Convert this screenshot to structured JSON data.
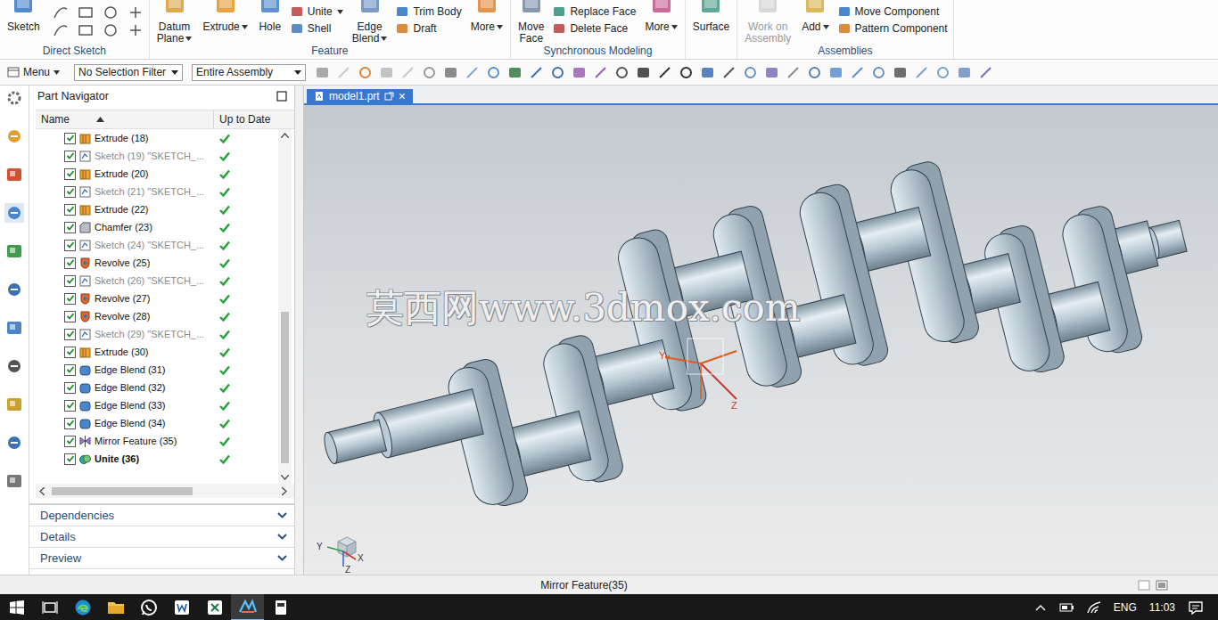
{
  "ribbon": {
    "groups": [
      {
        "label": "Direct Sketch",
        "items": [
          {
            "kind": "large",
            "lines": [
              "Sketch"
            ],
            "caret": false,
            "disabled": false
          },
          {
            "kind": "sketch-tools"
          }
        ]
      },
      {
        "label": "Feature",
        "items": [
          {
            "kind": "large",
            "lines": [
              "Datum",
              "Plane"
            ],
            "caret": true,
            "disabled": false
          },
          {
            "kind": "large",
            "lines": [
              "Extrude"
            ],
            "caret": true,
            "disabled": false
          },
          {
            "kind": "large",
            "lines": [
              "Hole"
            ],
            "caret": false,
            "disabled": false
          },
          {
            "kind": "stack",
            "buttons": [
              {
                "label": "Unite",
                "caret": true
              },
              {
                "label": "Shell",
                "caret": false
              }
            ]
          },
          {
            "kind": "large",
            "lines": [
              "Edge",
              "Blend"
            ],
            "caret": true,
            "disabled": false
          },
          {
            "kind": "stack",
            "buttons": [
              {
                "label": "Trim Body",
                "caret": false
              },
              {
                "label": "Draft",
                "caret": false
              }
            ]
          },
          {
            "kind": "large",
            "lines": [
              "More"
            ],
            "caret": true,
            "disabled": false
          }
        ]
      },
      {
        "label": "Synchronous Modeling",
        "items": [
          {
            "kind": "large",
            "lines": [
              "Move",
              "Face"
            ],
            "caret": false,
            "disabled": false
          },
          {
            "kind": "stack",
            "buttons": [
              {
                "label": "Replace Face",
                "caret": false
              },
              {
                "label": "Delete Face",
                "caret": false
              }
            ]
          },
          {
            "kind": "large",
            "lines": [
              "More"
            ],
            "caret": true,
            "disabled": false
          }
        ]
      },
      {
        "items": [
          {
            "kind": "large",
            "lines": [
              "Surface"
            ],
            "caret": false,
            "disabled": false
          }
        ]
      },
      {
        "label": "Assemblies",
        "items": [
          {
            "kind": "large",
            "lines": [
              "Work on",
              "Assembly"
            ],
            "caret": false,
            "disabled": true
          },
          {
            "kind": "large",
            "lines": [
              "Add"
            ],
            "caret": true,
            "disabled": false
          },
          {
            "kind": "stack",
            "buttons": [
              {
                "label": "Move Component",
                "caret": false
              },
              {
                "label": "Pattern Component",
                "caret": false
              }
            ]
          }
        ]
      }
    ]
  },
  "toolbar": {
    "menu": "Menu",
    "selection_filter": "No Selection Filter",
    "scope": "Entire Assembly"
  },
  "navigator": {
    "title": "Part Navigator",
    "columns": [
      "Name",
      "Up to Date"
    ],
    "sort_ascending": true,
    "rows": [
      {
        "name": "Extrude (18)",
        "kind": "extrude",
        "checked": true,
        "up_to_date": true,
        "greyed": false,
        "current": false
      },
      {
        "name": "Sketch (19) \"SKETCH_...",
        "kind": "sketch",
        "checked": true,
        "up_to_date": true,
        "greyed": true,
        "current": false
      },
      {
        "name": "Extrude (20)",
        "kind": "extrude",
        "checked": true,
        "up_to_date": true,
        "greyed": false,
        "current": false
      },
      {
        "name": "Sketch (21) \"SKETCH_...",
        "kind": "sketch",
        "checked": true,
        "up_to_date": true,
        "greyed": true,
        "current": false
      },
      {
        "name": "Extrude (22)",
        "kind": "extrude",
        "checked": true,
        "up_to_date": true,
        "greyed": false,
        "current": false
      },
      {
        "name": "Chamfer (23)",
        "kind": "chamfer",
        "checked": true,
        "up_to_date": true,
        "greyed": false,
        "current": false
      },
      {
        "name": "Sketch (24) \"SKETCH_...",
        "kind": "sketch",
        "checked": true,
        "up_to_date": true,
        "greyed": true,
        "current": false
      },
      {
        "name": "Revolve (25)",
        "kind": "revolve",
        "checked": true,
        "up_to_date": true,
        "greyed": false,
        "current": false
      },
      {
        "name": "Sketch (26) \"SKETCH_...",
        "kind": "sketch",
        "checked": true,
        "up_to_date": true,
        "greyed": true,
        "current": false
      },
      {
        "name": "Revolve (27)",
        "kind": "revolve",
        "checked": true,
        "up_to_date": true,
        "greyed": false,
        "current": false
      },
      {
        "name": "Revolve (28)",
        "kind": "revolve",
        "checked": true,
        "up_to_date": true,
        "greyed": false,
        "current": false
      },
      {
        "name": "Sketch (29) \"SKETCH_...",
        "kind": "sketch",
        "checked": true,
        "up_to_date": true,
        "greyed": true,
        "current": false
      },
      {
        "name": "Extrude (30)",
        "kind": "extrude",
        "checked": true,
        "up_to_date": true,
        "greyed": false,
        "current": false
      },
      {
        "name": "Edge Blend (31)",
        "kind": "blend",
        "checked": true,
        "up_to_date": true,
        "greyed": false,
        "current": false
      },
      {
        "name": "Edge Blend (32)",
        "kind": "blend",
        "checked": true,
        "up_to_date": true,
        "greyed": false,
        "current": false
      },
      {
        "name": "Edge Blend (33)",
        "kind": "blend",
        "checked": true,
        "up_to_date": true,
        "greyed": false,
        "current": false
      },
      {
        "name": "Edge Blend (34)",
        "kind": "blend",
        "checked": true,
        "up_to_date": true,
        "greyed": false,
        "current": false
      },
      {
        "name": "Mirror Feature (35)",
        "kind": "mirror",
        "checked": true,
        "up_to_date": true,
        "greyed": false,
        "current": false
      },
      {
        "name": "Unite (36)",
        "kind": "unite",
        "checked": true,
        "up_to_date": true,
        "greyed": false,
        "current": true
      }
    ],
    "sections": [
      {
        "label": "Dependencies",
        "expanded": false
      },
      {
        "label": "Details",
        "expanded": false
      },
      {
        "label": "Preview",
        "expanded": false
      }
    ]
  },
  "viewport": {
    "tab": {
      "label": "model1.prt",
      "close": "×",
      "selected": true
    },
    "watermark": "莫西网www.3dmox.com",
    "datum_csys": {
      "y": "Y",
      "z": "Z"
    },
    "view_triad": {
      "x": "X",
      "y": "Y",
      "z": "Z"
    }
  },
  "status_bar": {
    "message": "Mirror Feature(35)"
  },
  "taskbar": {
    "language": "ENG",
    "time": "11:03"
  }
}
